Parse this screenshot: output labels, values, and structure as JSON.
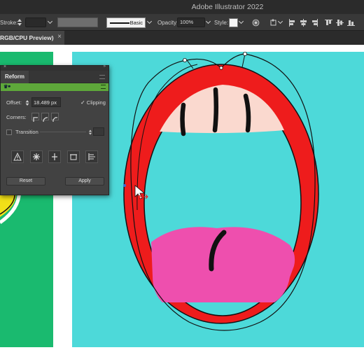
{
  "app": {
    "title": "Adobe Illustrator 2022"
  },
  "control_bar": {
    "stroke_label": "Stroke:",
    "brush_label": "Basic",
    "opacity_label": "Opacity:",
    "opacity_value": "100%",
    "style_label": "Style:"
  },
  "tabs": {
    "document_tab_label": "RGB/CPU Preview)",
    "close_glyph": "×"
  },
  "reform_panel": {
    "title": "Reform",
    "offset_label": "Offset:",
    "offset_value": "18.489 px",
    "clipping_label": "Clipping",
    "clipping_checked": true,
    "corners_label": "Corners:",
    "transition_label": "Transition",
    "transition_checked": false,
    "reset_label": "Reset",
    "apply_label": "Apply",
    "tools": [
      "warning-triangle-icon",
      "star-burst-icon",
      "cross-split-icon",
      "frame-box-icon",
      "align-left-icon"
    ]
  },
  "colors": {
    "canvas_cyan": "#4dd9d9",
    "green_artboard": "#1aba6f",
    "mouth_red": "#ee1c1c",
    "teeth_peach": "#fad9cf",
    "tongue_pink": "#ee4fae",
    "outline_black": "#111111",
    "selection_blue": "#3d6bd4",
    "panel_green": "#5ea83a"
  }
}
